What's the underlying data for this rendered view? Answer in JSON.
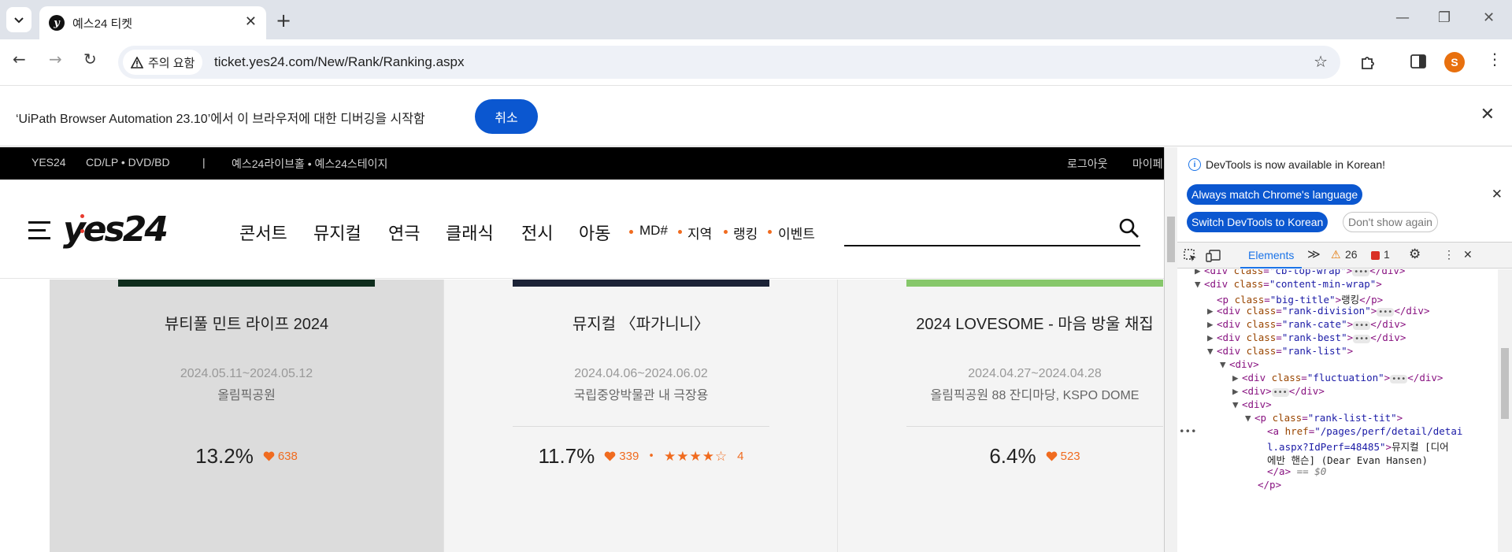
{
  "browser": {
    "tab_title": "예스24 티켓",
    "tab_favicon": "y",
    "url": "ticket.yes24.com/New/Rank/Ranking.aspx",
    "security_chip": "주의 요함",
    "avatar_letter": "S"
  },
  "infobar": {
    "message": "‘UiPath Browser Automation 23.10’에서 이 브라우저에 대한 디버깅을 시작함",
    "cancel_label": "취소"
  },
  "site": {
    "topbar": {
      "yes24": "YES24",
      "media": "CD/LP • DVD/BD",
      "sep": "|",
      "venues": "예스24라이브홀 • 예스24스테이지",
      "logout": "로그아웃",
      "mypage": "마이페"
    },
    "logo_text": "yes24",
    "nav_main": [
      "콘서트",
      "뮤지컬",
      "연극",
      "클래식",
      "전시",
      "아동"
    ],
    "nav_sub": [
      "MD#",
      "지역",
      "랭킹",
      "이벤트"
    ],
    "cards": [
      {
        "title": "뷰티풀 민트 라이프 2024",
        "date": "2024.05.11~2024.05.12",
        "venue": "올림픽공원",
        "percent": "13.2%",
        "likes": "638",
        "bg": "#dcdcdc",
        "poster": "#0f2d1d"
      },
      {
        "title": "뮤지컬 〈파가니니〉",
        "date": "2024.04.06~2024.06.02",
        "venue": "국립중앙박물관 내 극장용",
        "percent": "11.7%",
        "likes": "339",
        "rating_stars": "★★★★☆",
        "reviews": "4",
        "bg": "#f4f4f4",
        "poster": "#1c2337"
      },
      {
        "title": "2024 LOVESOME - 마음 방울 채집",
        "date": "2024.04.27~2024.04.28",
        "venue": "올림픽공원 88 잔디마당, KSPO DOME",
        "percent": "6.4%",
        "likes": "523",
        "bg": "#f4f4f4",
        "poster": "#86c76a"
      }
    ]
  },
  "devtools": {
    "notice": "DevTools is now available in Korean!",
    "btn_match": "Always match Chrome's language",
    "btn_switch": "Switch DevTools to Korean",
    "btn_dont_show": "Don't show again",
    "tab_elements": "Elements",
    "more_tabs": "≫",
    "warnings": "26",
    "errors": "1",
    "tree": {
      "l0": [
        "div",
        "class",
        "cb-top-wrap"
      ],
      "l1": [
        "div",
        "class",
        "content-min-wrap"
      ],
      "l2_tag": "p",
      "l2_attr": "class",
      "l2_val": "big-title",
      "l2_text": "랭킹",
      "l3": "rank-division",
      "l4": "rank-cate",
      "l5": "rank-best",
      "l6": "rank-list",
      "l7": "div",
      "l8": "fluctuation",
      "l9": "div",
      "l10": "div",
      "l11_val": "rank-list-tit",
      "sel_href1": "/pages/perf/detail/detai",
      "sel_href2": "l.aspx?IdPerf=48485",
      "sel_text1": "뮤지컬 [디어",
      "sel_text2": "에반 핸슨] (Dear Evan Hansen)",
      "sel_close": "</a>",
      "sel_eq": "== $0",
      "close_p": "</p>"
    }
  }
}
